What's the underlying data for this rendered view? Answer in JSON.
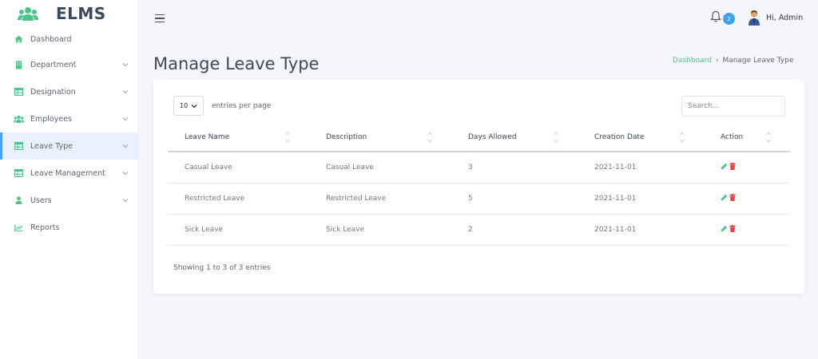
{
  "app": {
    "name": "ELMS"
  },
  "sidebar": {
    "items": [
      {
        "label": "Dashboard",
        "icon": "home-icon",
        "expandable": false
      },
      {
        "label": "Department",
        "icon": "building-icon",
        "expandable": true
      },
      {
        "label": "Designation",
        "icon": "table-icon",
        "expandable": true
      },
      {
        "label": "Employees",
        "icon": "users-icon",
        "expandable": true
      },
      {
        "label": "Leave Type",
        "icon": "table-icon",
        "expandable": true,
        "active": true
      },
      {
        "label": "Leave Management",
        "icon": "table-icon",
        "expandable": true
      },
      {
        "label": "Users",
        "icon": "user-icon",
        "expandable": true
      },
      {
        "label": "Reports",
        "icon": "chart-icon",
        "expandable": false
      }
    ]
  },
  "topbar": {
    "notification_count": "2",
    "greeting": "Hi, Admin"
  },
  "page": {
    "title": "Manage Leave Type"
  },
  "breadcrumb": {
    "link": "Dashboard",
    "separator": "›",
    "current": "Manage Leave Type"
  },
  "table_controls": {
    "page_length": "10",
    "length_text": "entries per page",
    "search_placeholder": "Search..."
  },
  "table": {
    "headers": [
      "Leave Name",
      "Description",
      "Days Allowed",
      "Creation Date",
      "Action"
    ],
    "rows": [
      [
        "Casual Leave",
        "Casual Leave",
        "3",
        "2021-11-01"
      ],
      [
        "Restricted Leave",
        "Restricted Leave",
        "5",
        "2021-11-01"
      ],
      [
        "Sick Leave",
        "Sick Leave",
        "2",
        "2021-11-01"
      ]
    ]
  },
  "table_info": "Showing 1 to 3 of 3 entries",
  "colors": {
    "accent": "#4cc58a",
    "badge": "#3ba2f0",
    "edit": "#4cc58a",
    "delete": "#e8403e",
    "active_bg": "#e8f1fc"
  }
}
